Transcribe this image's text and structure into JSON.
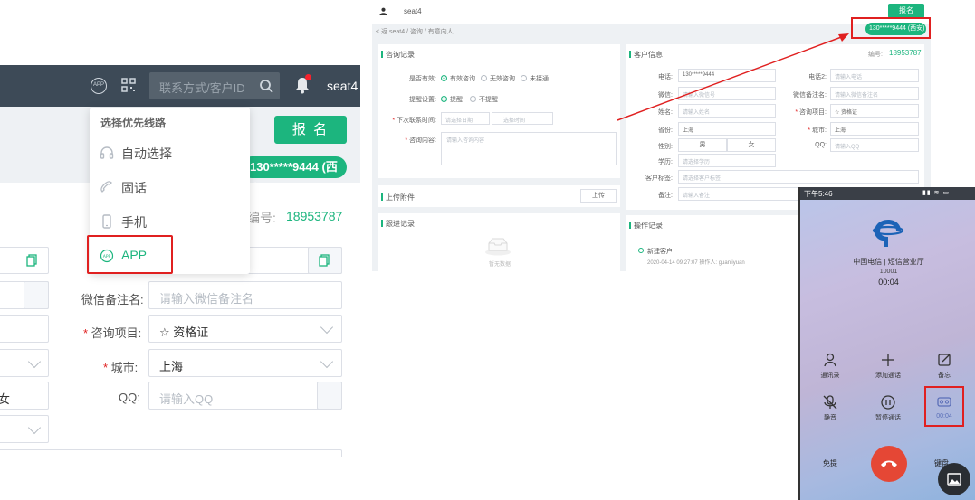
{
  "left_panel": {
    "header": {
      "search_placeholder": "联系方式/客户ID",
      "app_icon_text": "APP",
      "user_name": "seat4"
    },
    "line_menu": {
      "title": "选择优先线路",
      "items": [
        {
          "label": "自动选择",
          "icon": "headset-icon"
        },
        {
          "label": "固话",
          "icon": "handset-icon"
        },
        {
          "label": "手机",
          "icon": "mobile-icon"
        },
        {
          "label": "APP",
          "icon": "app-icon"
        }
      ]
    },
    "signup_button": "报 名",
    "phone_pill": "130*****9444 (西安)",
    "number_label": "编号:",
    "number_value": "18953787",
    "form": {
      "wechat_remark_label": "微信备注名:",
      "wechat_remark_placeholder": "请输入微信备注名",
      "consult_label": "咨询项目:",
      "consult_value": "☆ 资格证",
      "city_label": "城市:",
      "city_value": "上海",
      "qq_label": "QQ:",
      "qq_placeholder": "请输入QQ",
      "gender_partial": "女"
    }
  },
  "mid_panel": {
    "seat_name": "seat4",
    "signup_button": "报名",
    "breadcrumb": "< 返 seat4 / 咨询 / 有意向人",
    "phone_pill": "130*****9444 (西安)",
    "consult_card_title": "咨询记录",
    "is_valid_label": "是否有效:",
    "is_valid_options": [
      "有效咨询",
      "无效咨询",
      "未接通"
    ],
    "remind_label": "提醒设置:",
    "remind_options": [
      "提醒",
      "不提醒"
    ],
    "next_contact_label": "下次联系时间:",
    "next_contact_ph1": "请选择日期",
    "next_contact_ph2": "选择时间",
    "consult_content_label": "咨询内容:",
    "consult_content_ph": "请输入咨询内容",
    "upload_title": "上传附件",
    "upload_button": "上传",
    "follow_title": "跟进记录",
    "empty_text": "暂无数据",
    "customer_card_title": "客户信息",
    "id_label": "编号:",
    "id_value": "18953787",
    "fields_left": [
      {
        "label": "电话:",
        "value": "130*****9444"
      },
      {
        "label": "微信:",
        "value": "请输入微信号"
      },
      {
        "label": "姓名:",
        "value": "请输入姓名"
      },
      {
        "label": "省份:",
        "value": "上海"
      },
      {
        "label": "性别:",
        "value": "男"
      },
      {
        "label": "学历:",
        "value": "请选择学历"
      },
      {
        "label": "客户标签:",
        "value": "请选择客户标签"
      },
      {
        "label": "备注:",
        "value": "请输入备注"
      }
    ],
    "fields_right": [
      {
        "label": "电话2:",
        "value": "请输入电话"
      },
      {
        "label": "微信备注名:",
        "value": "请输入微信备注名"
      },
      {
        "label": "咨询项目:",
        "value": "☆ 资格证"
      },
      {
        "label": "城市:",
        "value": "上海"
      },
      {
        "label": "QQ:",
        "value": "请输入QQ"
      }
    ],
    "gender_female": "女",
    "record_title": "操作记录",
    "record_event": "新建客户",
    "record_meta": "2020-04-14 09:27:07  操作人: guanliyuan"
  },
  "phone": {
    "status_time": "下午5:46",
    "status_icons": "▮▮ ≋ ▭",
    "carrier": "中国电信 | 短信营业厅",
    "number": "10001",
    "duration": "00:04",
    "buttons": [
      {
        "label": "通讯录",
        "icon": "contacts-icon"
      },
      {
        "label": "添加通话",
        "icon": "add-call-icon"
      },
      {
        "label": "备忘",
        "icon": "memo-icon"
      },
      {
        "label": "静音",
        "icon": "mute-icon"
      },
      {
        "label": "暂停通话",
        "icon": "pause-icon"
      },
      {
        "label": "00:04",
        "icon": "voicemail-icon"
      }
    ],
    "speaker_label": "免提",
    "keypad_label": "键盘"
  },
  "colors": {
    "accent": "#1cb57e",
    "header_dark": "#3d4a57",
    "highlight_red": "#e02020",
    "end_call": "#e54735"
  }
}
